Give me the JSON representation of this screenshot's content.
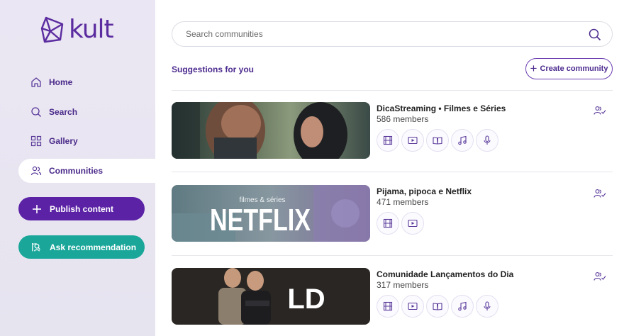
{
  "app": {
    "logo_text": "kult"
  },
  "sidebar": {
    "items": [
      {
        "label": "Home",
        "icon": "home-icon"
      },
      {
        "label": "Search",
        "icon": "search-icon"
      },
      {
        "label": "Gallery",
        "icon": "gallery-icon"
      },
      {
        "label": "Communities",
        "icon": "communities-icon",
        "active": true
      }
    ],
    "publish_label": "Publish content",
    "ask_label": "Ask recommendation"
  },
  "search": {
    "placeholder": "Search communities"
  },
  "main": {
    "section_title": "Suggestions for you",
    "create_label": "Create community"
  },
  "communities": [
    {
      "title": "DicaStreaming • Filmes e Séries",
      "members": "586 members",
      "content_types": [
        "film-icon",
        "video-icon",
        "book-icon",
        "music-icon",
        "podcast-icon"
      ]
    },
    {
      "title": "Pijama, pipoca e Netflix",
      "members": "471 members",
      "content_types": [
        "film-icon",
        "video-icon"
      ],
      "thumb_text": {
        "small": "filmes & séries",
        "big": "NETFLIX"
      }
    },
    {
      "title": "Comunidade Lançamentos do Dia",
      "members": "317 members",
      "content_types": [
        "film-icon",
        "video-icon",
        "book-icon",
        "music-icon",
        "podcast-icon"
      ],
      "thumb_text": {
        "logo": "LD"
      }
    }
  ],
  "colors": {
    "brand": "#5b22a6",
    "accent_teal": "#1aa79a",
    "text_purple": "#4b2a8e"
  }
}
